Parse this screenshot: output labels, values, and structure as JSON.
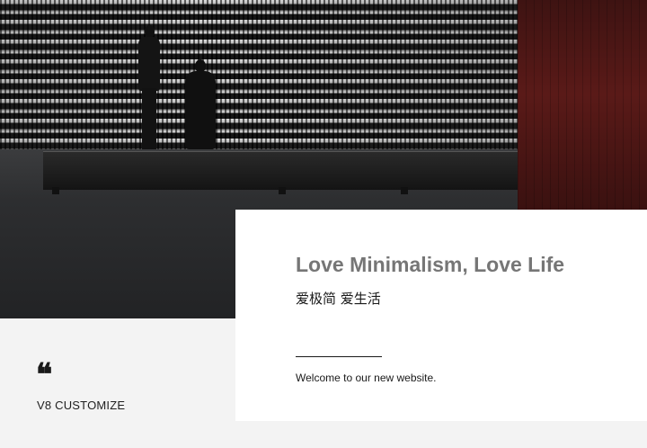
{
  "hero": {
    "photo_description_name": "gallery-hero-photo"
  },
  "caption": {
    "quote_glyph": "❝",
    "brand": "V8 CUSTOMIZE"
  },
  "card": {
    "title": "Love Minimalism, Love Life",
    "subtitle": "爱极简  爱生活",
    "welcome": "Welcome to our new website."
  },
  "colors": {
    "background": "#f3f3f3",
    "card": "#ffffff",
    "title": "#767676",
    "text": "#1a1a1a",
    "accent_red": "#5a1a18"
  }
}
